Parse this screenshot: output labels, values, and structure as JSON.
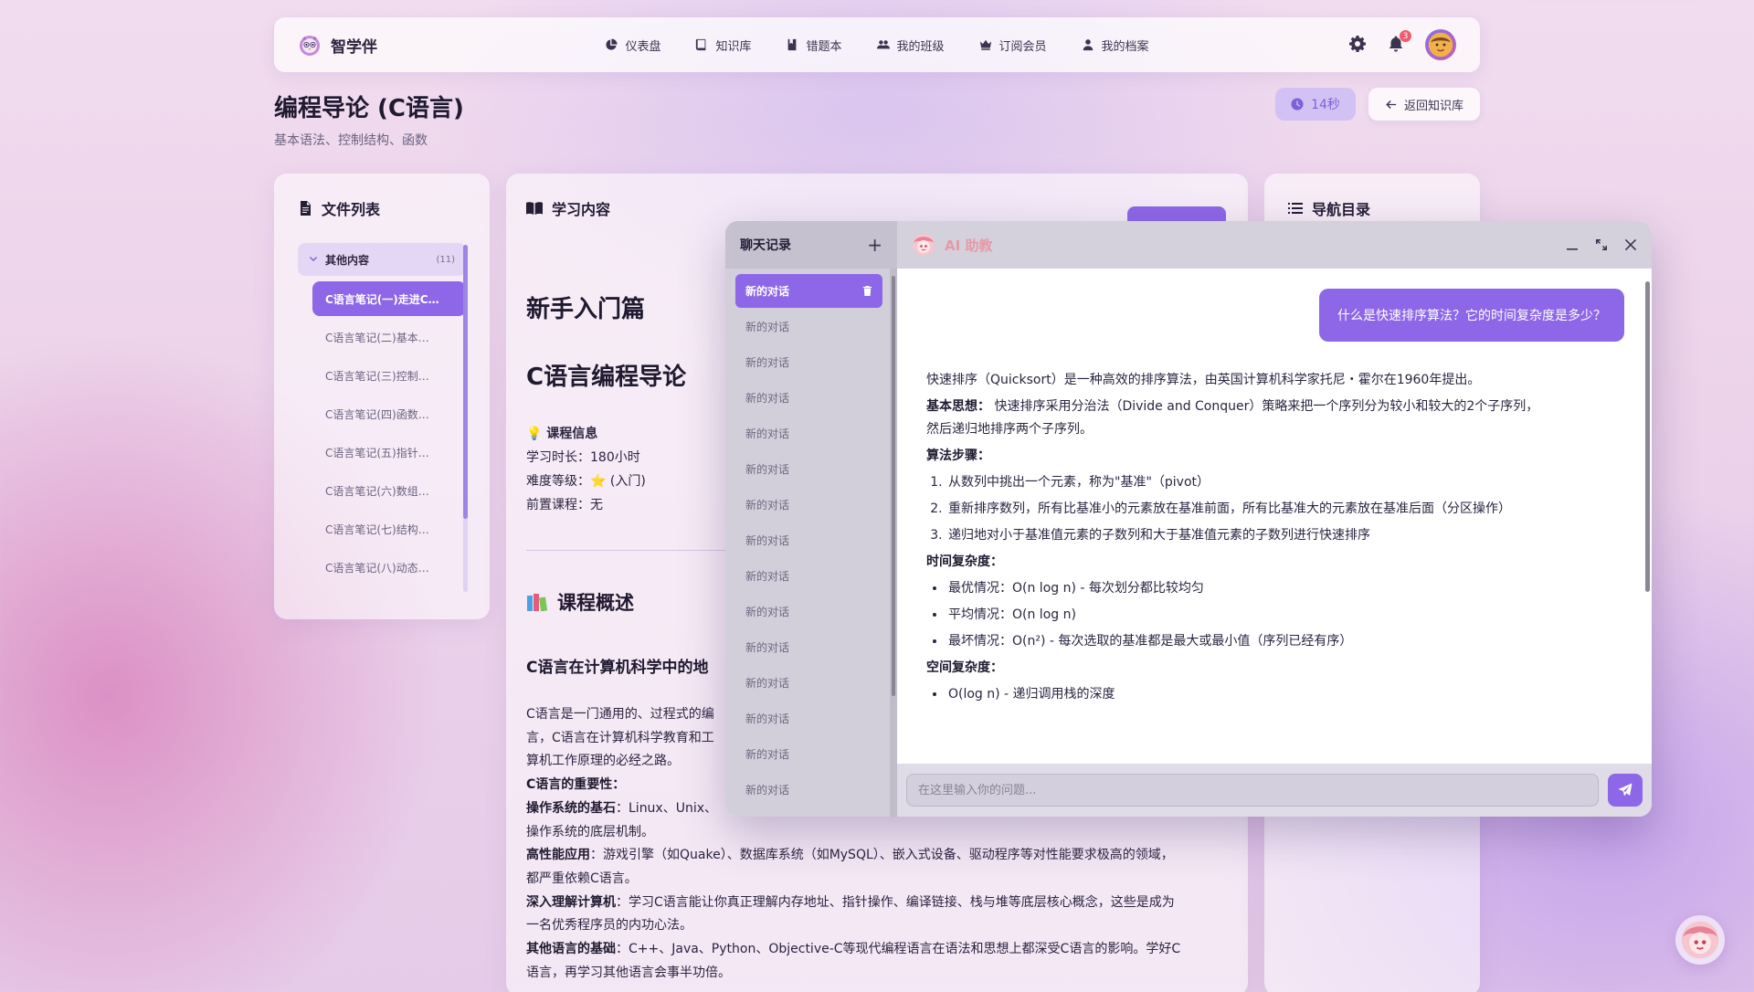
{
  "app": {
    "brand_name": "智学伴",
    "logo_icon": "owl-logo-icon"
  },
  "nav": {
    "items": [
      {
        "label": "仪表盘",
        "icon": "pie-chart-icon"
      },
      {
        "label": "知识库",
        "icon": "book-icon"
      },
      {
        "label": "错题本",
        "icon": "bookmark-book-icon"
      },
      {
        "label": "我的班级",
        "icon": "users-icon"
      },
      {
        "label": "订阅会员",
        "icon": "crown-icon"
      },
      {
        "label": "我的档案",
        "icon": "user-icon"
      }
    ],
    "notification_count": "3",
    "accent": "#8d67e8"
  },
  "page": {
    "title": "编程导论 (C语言)",
    "subtitle": "基本语法、控制结构、函数",
    "timer": "14秒",
    "back_label": "返回知识库"
  },
  "files": {
    "title": "文件列表",
    "group_name": "其他内容",
    "group_count": "(11)",
    "items": [
      "C语言笔记(一)走进C…",
      "C语言笔记(二)基本…",
      "C语言笔记(三)控制…",
      "C语言笔记(四)函数…",
      "C语言笔记(五)指针…",
      "C语言笔记(六)数组…",
      "C语言笔记(七)结构…",
      "C语言笔记(八)动态…"
    ]
  },
  "content": {
    "title": "学习内容",
    "h_intro": "新手入门篇",
    "h_course": "C语言编程导论",
    "info_title": "💡 课程信息",
    "info_lines": [
      "学习时长：180小时",
      "难度等级：⭐ (入门)",
      "前置课程：无"
    ],
    "h_overview": "课程概述",
    "h_sub": "C语言在计算机科学中的地",
    "para1": "C语言是一门通用的、过程式的编",
    "para2": "言，C语言在计算机科学教育和工",
    "para3": "算机工作原理的必经之路。",
    "importance_title": "C语言的重要性：",
    "b1_title": "操作系统的基石",
    "b1_text": "：Linux、Unix、",
    "b1_text2": "操作系统的底层机制。",
    "b2_title": "高性能应用",
    "b2_text": "：游戏引擎（如Quake）、数据库系统（如MySQL）、嵌入式设备、驱动程序等对性能要求极高的领域，",
    "b2_text2": "都严重依赖C语言。",
    "b3_title": "深入理解计算机",
    "b3_text": "：学习C语言能让你真正理解内存地址、指针操作、编译链接、栈与堆等底层核心概念，这些是成为",
    "b3_text2": "一名优秀程序员的内功心法。",
    "b4_title": "其他语言的基础",
    "b4_text": "：C++、Java、Python、Objective-C等现代编程语言在语法和思想上都深受C语言的影响。学好C",
    "b4_text2": "语言，再学习其他语言会事半功倍。"
  },
  "toc": {
    "title": "导航目录"
  },
  "chat": {
    "sidebar_title": "聊天记录",
    "new_label": "+",
    "conversations": [
      "新的对话",
      "新的对话",
      "新的对话",
      "新的对话",
      "新的对话",
      "新的对话",
      "新的对话",
      "新的对话",
      "新的对话",
      "新的对话",
      "新的对话",
      "新的对话",
      "新的对话",
      "新的对话",
      "新的对话"
    ],
    "bot_name": "AI 助教",
    "user_message": "什么是快速排序算法？它的时间复杂度是多少？",
    "answer": {
      "intro": "快速排序（Quicksort）是一种高效的排序算法，由英国计算机科学家托尼・霍尔在1960年提出。",
      "idea_title": "基本思想：",
      "idea_text": " 快速排序采用分治法（Divide and Conquer）策略来把一个序列分为较小和较大的2个子序列，然后递归地排序两个子序列。",
      "steps_title": "算法步骤：",
      "steps": [
        "从数列中挑出一个元素，称为\"基准\"（pivot）",
        "重新排序数列，所有比基准小的元素放在基准前面，所有比基准大的元素放在基准后面（分区操作）",
        "递归地对小于基准值元素的子数列和大于基准值元素的子数列进行快速排序"
      ],
      "time_title": "时间复杂度：",
      "time_items": [
        "最优情况：O(n log n) - 每次划分都比较均匀",
        "平均情况：O(n log n)",
        "最坏情况：O(n²) - 每次选取的基准都是最大或最小值（序列已经有序）"
      ],
      "space_title": "空间复杂度：",
      "space_items": [
        "O(log n) - 递归调用栈的深度"
      ]
    },
    "input_placeholder": "在这里输入你的问题..."
  }
}
